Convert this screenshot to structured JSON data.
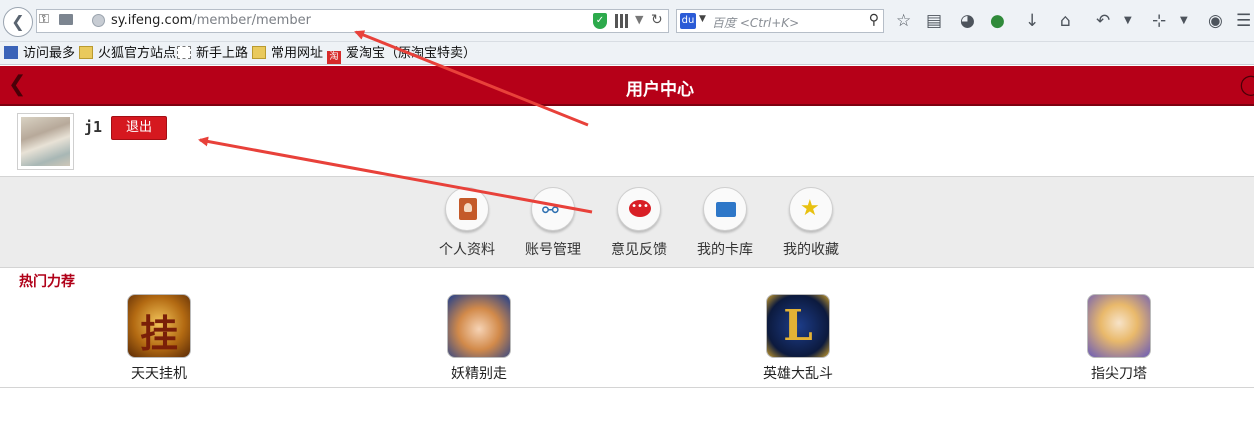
{
  "browser": {
    "url_host": "sy.ifeng.com",
    "url_path": "/member/member",
    "search_placeholder": "百度 <Ctrl+K>",
    "search_engine_badge": "du"
  },
  "bookmarks": [
    {
      "label": "访问最多",
      "icon": "bookmark-star-icon"
    },
    {
      "label": "火狐官方站点",
      "icon": "folder-icon"
    },
    {
      "label": "新手上路",
      "icon": "page-icon"
    },
    {
      "label": "常用网址",
      "icon": "folder-icon"
    },
    {
      "label": "爱淘宝（原淘宝特卖）",
      "icon": "taobao-icon",
      "badge": "淘"
    }
  ],
  "header": {
    "title": "用户中心"
  },
  "profile": {
    "username": "j1",
    "logout_label": "退出"
  },
  "menu": [
    {
      "label": "个人资料",
      "icon": "profile-card-icon"
    },
    {
      "label": "账号管理",
      "icon": "link-icon"
    },
    {
      "label": "意见反馈",
      "icon": "chat-bubble-icon"
    },
    {
      "label": "我的卡库",
      "icon": "folder-icon"
    },
    {
      "label": "我的收藏",
      "icon": "star-icon"
    }
  ],
  "hot": {
    "title": "热门力荐",
    "games": [
      {
        "label": "天天挂机",
        "badge": "挂"
      },
      {
        "label": "妖精别走"
      },
      {
        "label": "英雄大乱斗",
        "badge": "L"
      },
      {
        "label": "指尖刀塔"
      }
    ]
  },
  "colors": {
    "header_red": "#b60018",
    "logout_red": "#d5181f",
    "section_red": "#b00018",
    "annotation_arrow": "#e8413a"
  }
}
